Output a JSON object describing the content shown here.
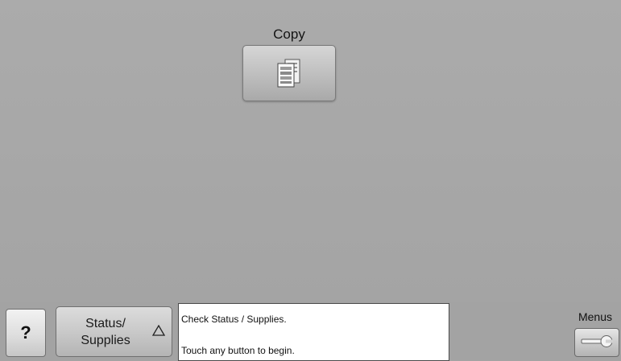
{
  "home": {
    "copy_label": "Copy",
    "copy_icon": "copy-document-icon"
  },
  "bottom_bar": {
    "help_label": "?",
    "status_line1": "Status/",
    "status_line2": "Supplies",
    "status_icon": "triangle-up-icon",
    "message_line1": "Check Status / Supplies.",
    "message_line2": "Touch any button to begin.",
    "menus_label": "Menus",
    "menus_icon": "wrench-icon"
  },
  "colors": {
    "background": "#a8a8a8",
    "button_face": "#c9c9c9",
    "message_background": "#ffffff",
    "text": "#111111"
  }
}
